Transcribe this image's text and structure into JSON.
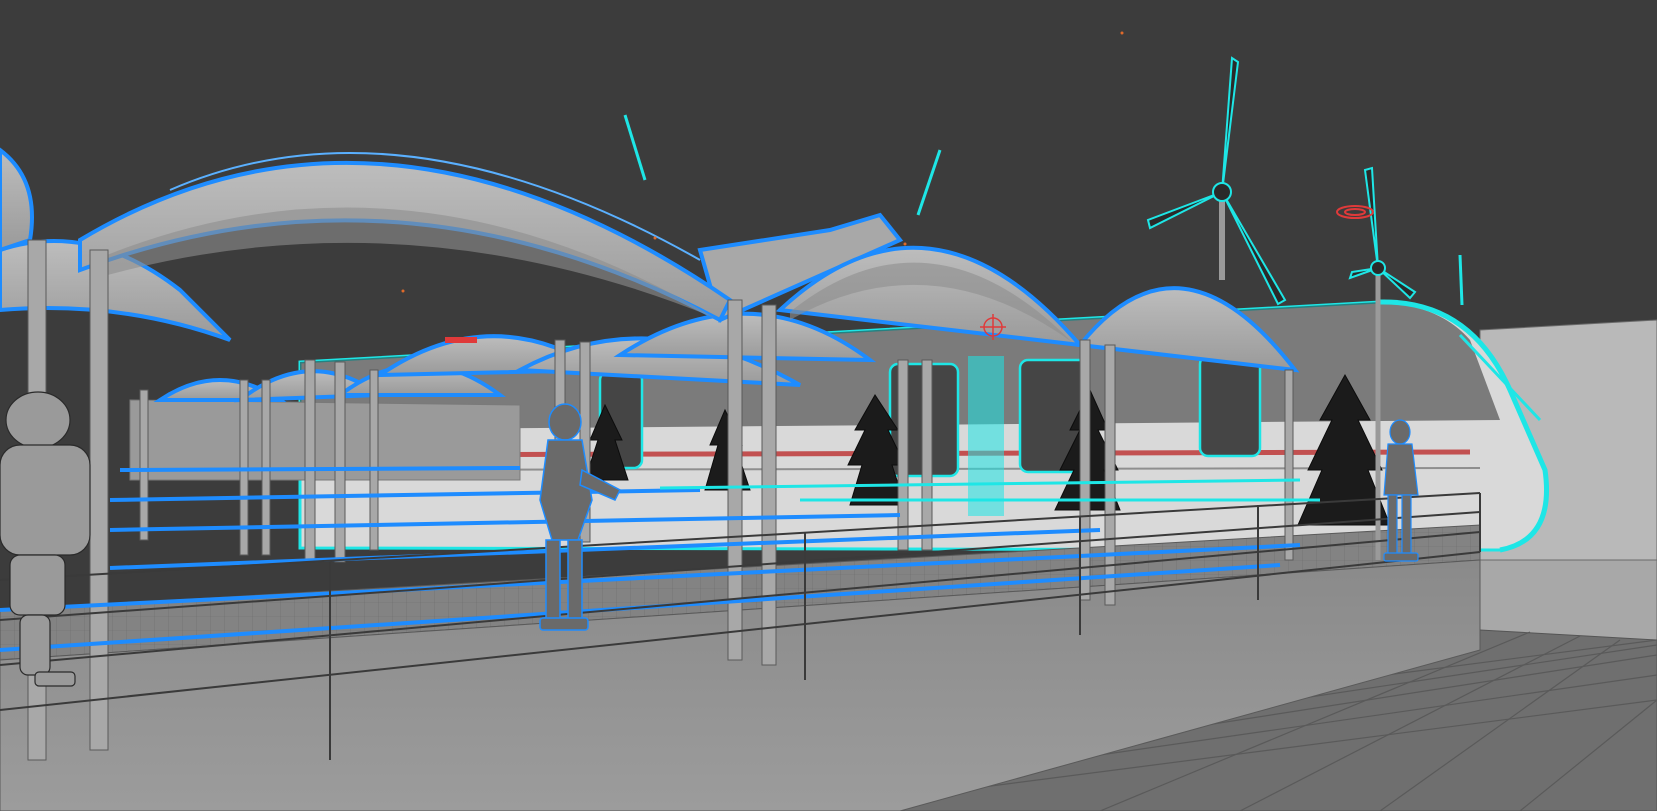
{
  "viewport": {
    "background": "#3c3c3c",
    "selection_color": "#1e8cff",
    "highlight_color": "#1ee6e6",
    "geometry_color": "#b4b4b4",
    "marker_color": "#e03a3a"
  },
  "scene_objects": [
    "platform-canopy",
    "train",
    "wind-turbine",
    "robot-figure",
    "conifer-tree",
    "railing",
    "paved-ground"
  ],
  "icons": {
    "pivot": "crosshair-icon",
    "light": "light-marker-icon"
  }
}
